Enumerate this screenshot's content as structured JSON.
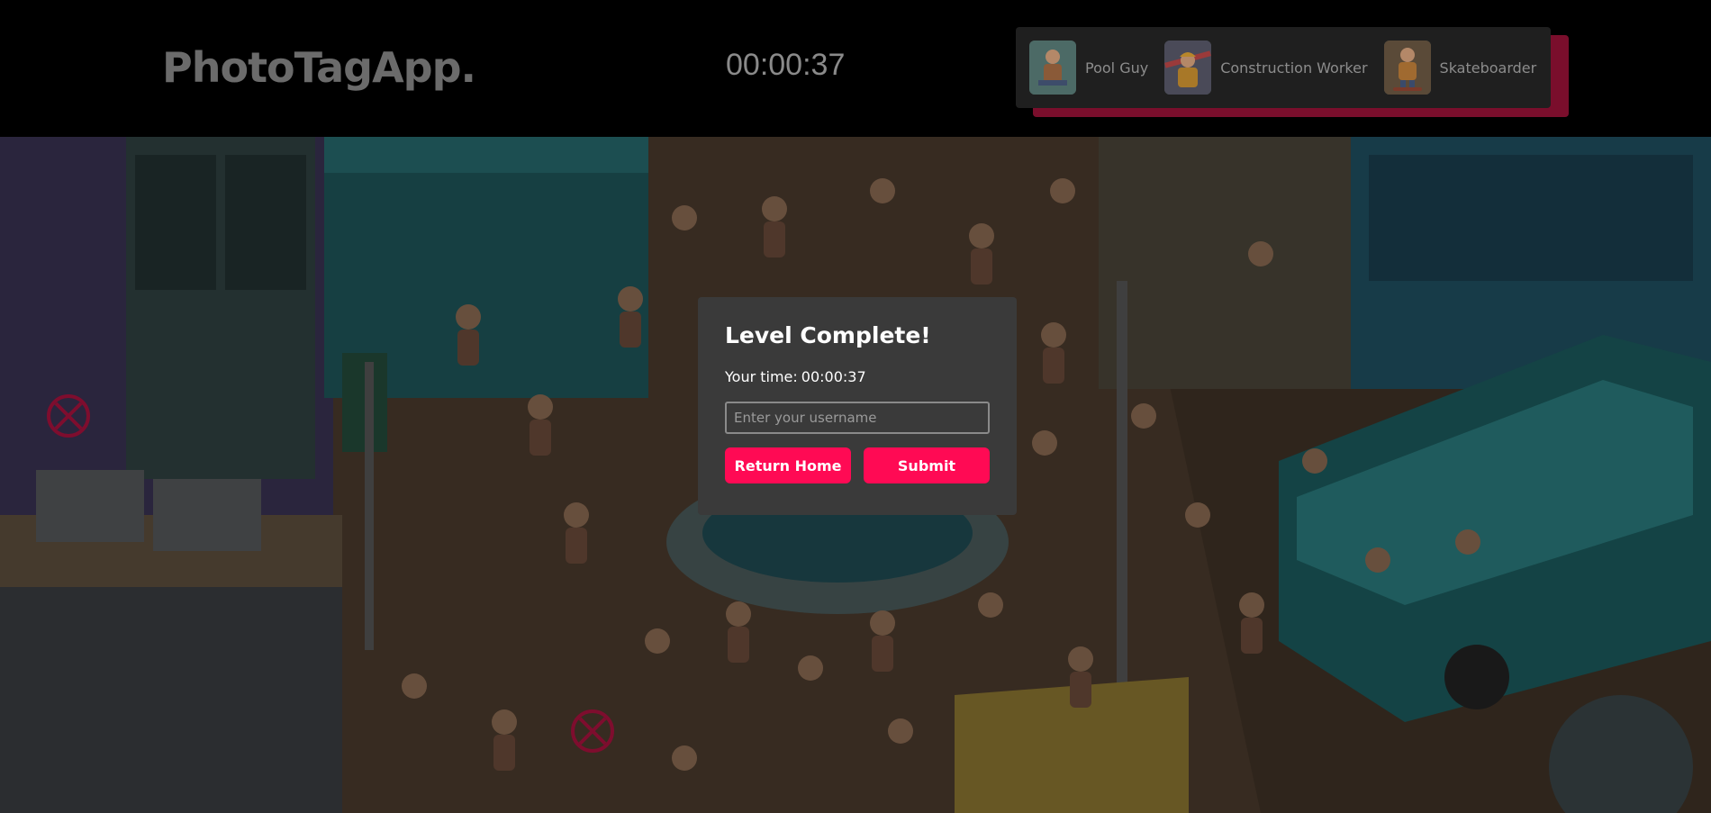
{
  "header": {
    "logo": "PhotoTagApp.",
    "timer": "00:00:37"
  },
  "targets": [
    {
      "name": "Pool Guy",
      "icon": "pool-guy-thumbnail"
    },
    {
      "name": "Construction Worker",
      "icon": "construction-worker-thumbnail"
    },
    {
      "name": "Skateboarder",
      "icon": "skateboarder-thumbnail"
    }
  ],
  "scene": {
    "markers": [
      {
        "icon": "wrong-guess-x-icon"
      },
      {
        "icon": "wrong-guess-x-icon"
      }
    ]
  },
  "modal": {
    "title": "Level Complete!",
    "time_label": "Your time:",
    "time_value": "00:00:37",
    "username_placeholder": "Enter your username",
    "username_value": "",
    "return_home_label": "Return Home",
    "submit_label": "Submit"
  },
  "colors": {
    "accent": "#ff0a54",
    "header_bg": "#000000",
    "modal_bg": "#3a3a3a",
    "targets_shadow": "#7a0e2c"
  }
}
